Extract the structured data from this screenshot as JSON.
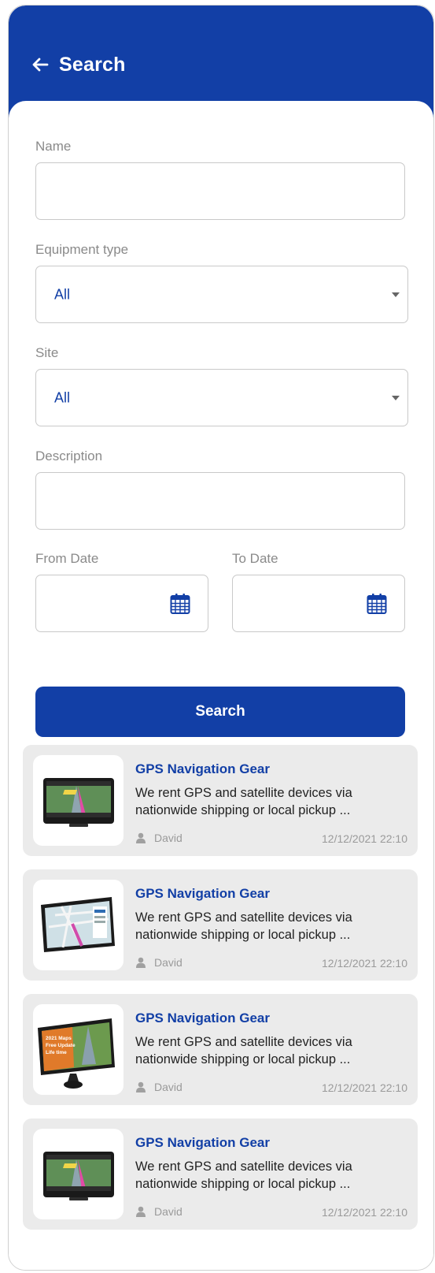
{
  "header": {
    "title": "Search",
    "back_icon": "arrow-left-icon"
  },
  "form": {
    "name_label": "Name",
    "name_value": "",
    "equipment_label": "Equipment type",
    "equipment_value": "All",
    "site_label": "Site",
    "site_value": "All",
    "description_label": "Description",
    "description_value": "",
    "from_label": "From Date",
    "to_label": "To Date",
    "calendar_icon": "calendar-icon",
    "search_button": "Search"
  },
  "results": [
    {
      "title": "GPS Navigation Gear",
      "desc_line1": "We rent GPS and satellite devices via",
      "desc_line2": "nationwide shipping or local pickup ...",
      "author": "David",
      "date": "12/12/2021 22:10",
      "image": "gps-device-image"
    },
    {
      "title": "GPS Navigation Gear",
      "desc_line1": "We rent GPS and satellite devices via",
      "desc_line2": "nationwide shipping or local pickup ...",
      "author": "David",
      "date": "12/12/2021 22:10",
      "image": "gps-device-image"
    },
    {
      "title": "GPS Navigation Gear",
      "desc_line1": "We rent GPS and satellite devices via",
      "desc_line2": "nationwide shipping or local pickup ...",
      "author": "David",
      "date": "12/12/2021 22:10",
      "image": "gps-device-image",
      "image_text": [
        "2021 Maps",
        "Free Update",
        "Life time"
      ]
    },
    {
      "title": "GPS Navigation Gear",
      "desc_line1": "We rent GPS and satellite devices via",
      "desc_line2": "nationwide shipping or local pickup ...",
      "author": "David",
      "date": "12/12/2021 22:10",
      "image": "gps-device-image"
    }
  ],
  "colors": {
    "primary": "#123fa6",
    "card_bg": "#ebebeb",
    "label": "#8a8a8a",
    "meta": "#9a9a9a"
  }
}
